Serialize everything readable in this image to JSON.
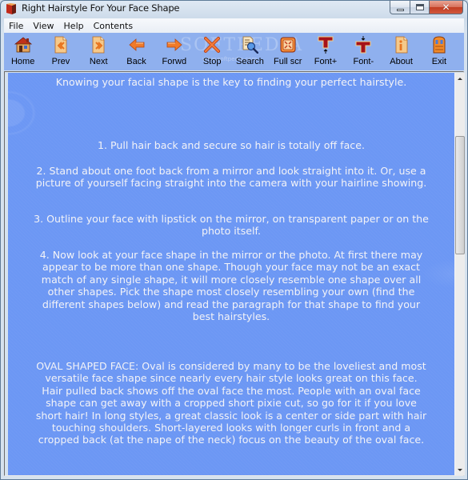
{
  "window": {
    "title": "Right Hairstyle For Your Face Shape",
    "caption": {
      "minimize": "minimize",
      "maximize": "maximize",
      "close": "✕"
    }
  },
  "menu": {
    "items": [
      {
        "label": "File"
      },
      {
        "label": "View"
      },
      {
        "label": "Help"
      },
      {
        "label": "Contents"
      }
    ]
  },
  "toolbar": {
    "buttons": [
      {
        "label": "Home",
        "icon": "home-icon"
      },
      {
        "label": "Prev",
        "icon": "prev-page-icon"
      },
      {
        "label": "Next",
        "icon": "next-page-icon"
      },
      {
        "label": "Back",
        "icon": "back-arrow-icon"
      },
      {
        "label": "Forwd",
        "icon": "forward-arrow-icon"
      },
      {
        "label": "Stop",
        "icon": "stop-x-icon"
      },
      {
        "label": "Search",
        "icon": "search-magnifier-icon"
      },
      {
        "label": "Full scr",
        "icon": "fullscreen-icon"
      },
      {
        "label": "Font+",
        "icon": "font-increase-icon"
      },
      {
        "label": "Font-",
        "icon": "font-decrease-icon"
      },
      {
        "label": "About",
        "icon": "about-info-icon"
      },
      {
        "label": "Exit",
        "icon": "exit-door-icon"
      }
    ],
    "watermark": "SOFTPEDIA",
    "watermark_sub": "www.softpedia.com"
  },
  "content": {
    "intro": "Knowing your facial shape is the key to finding your perfect hairstyle.",
    "step1": "1. Pull hair back and secure so hair is totally off face.",
    "step2": "2. Stand about one foot back from a mirror and look straight into it. Or, use a picture of yourself facing straight into the camera with your hairline showing.",
    "step3": "3. Outline your face with lipstick on the mirror, on transparent paper or on the photo itself.",
    "step4": "4. Now look at your face shape in the mirror or the photo. At first there may appear to be more than one shape. Though your face may not be an exact match of any single shape, it will more closely resemble one shape over all other shapes. Pick the shape most closely resembling your own (find the different shapes below) and read the paragraph for that shape to find your best hairstyles.",
    "oval": "OVAL SHAPED FACE: Oval is considered by many to be the loveliest and most versatile face shape since nearly every hair style looks great on this face. Hair pulled back shows off the oval face the most. People with an oval face shape can get away with a cropped short pixie cut, so go for it if you love short hair! In long styles, a great classic look is a center or side part with hair touching shoulders. Short-layered looks with longer curls in front and a cropped back (at the nape of the neck) focus on the beauty of the oval face."
  },
  "colors": {
    "toolbar_bg": "#8fb0ee",
    "content_bg": "#6c97f4",
    "content_text": "#f3f3f7",
    "icon_orange": "#e8731e",
    "icon_red": "#a5121a"
  }
}
